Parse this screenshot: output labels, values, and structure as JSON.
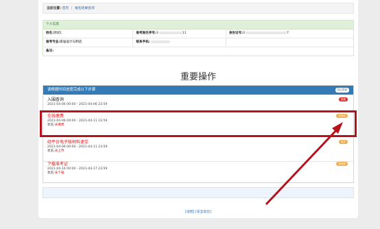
{
  "breadcrumb": {
    "label": "当前位置:",
    "home": "首页",
    "separator": "|",
    "current": "报名结果查询"
  },
  "personal_info": {
    "header": "个人信息",
    "name_label": "姓名:",
    "name_value": "测试1",
    "exam_no_label": "报考报名序号:",
    "exam_no_prefix": "3",
    "exam_no_suffix": "11",
    "id_label": "身份证号:",
    "id_prefix": "3",
    "id_suffix": "7",
    "major_label": "报考专业:",
    "major_value": "家居设计与制造",
    "phone_label": "联系手机:",
    "remark_label": "备注:"
  },
  "section_title": "重要操作",
  "panel": {
    "heading": "请根据时间进度完成以下步骤",
    "badge": "招生章程"
  },
  "steps": [
    {
      "title": "入围查询",
      "date": "2021-04-06 00:00 - 2021-04-06 23:59",
      "status_label": "",
      "status_value": "",
      "tag": "查看"
    },
    {
      "title": "在线缴费",
      "date": "2021-04-06 00:00 - 2021-04-11 23:59",
      "status_label": "状态:",
      "status_value": "未缴费",
      "tag": "未完成"
    },
    {
      "title": "经平台电子版材料递交",
      "date": "2021-04-06 00:00 - 2021-04-11 23:59",
      "status_label": "状态:",
      "status_value": "未上传",
      "tag": "未开"
    },
    {
      "title": "下载准考证",
      "date": "2021-04-16 00:00 - 2021-04-17 23:59",
      "status_label": "状态:",
      "status_value": "未下载",
      "tag": "未完成"
    }
  ],
  "footer": {
    "back": "[返回]",
    "logout": "[安全退出]"
  },
  "colors": {
    "highlight": "#b5121b",
    "panel_header": "#337ab7",
    "status_red": "#e01818",
    "tag_orange": "#f0ad4e"
  }
}
